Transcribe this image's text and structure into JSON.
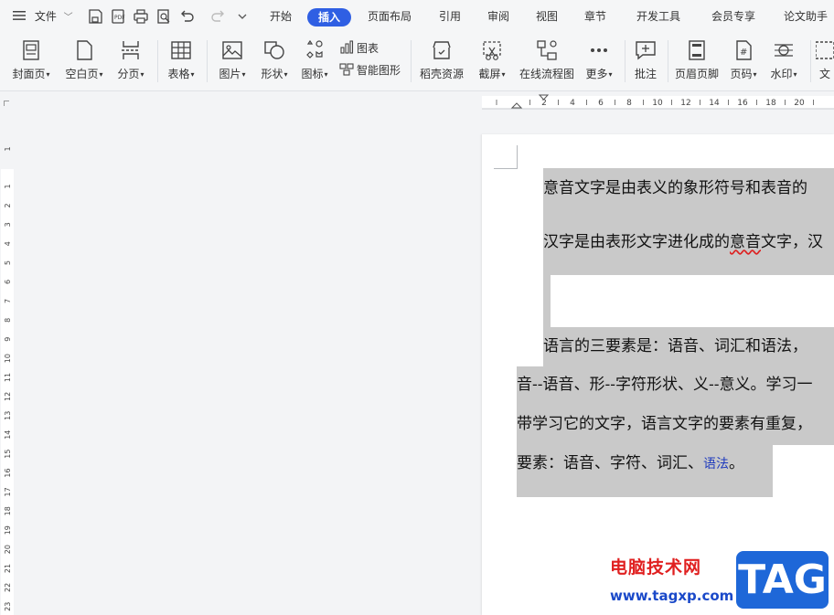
{
  "menu": {
    "file_label": "文件"
  },
  "tabs": [
    {
      "label": "开始"
    },
    {
      "label": "插入",
      "active": true
    },
    {
      "label": "页面布局"
    },
    {
      "label": "引用"
    },
    {
      "label": "审阅"
    },
    {
      "label": "视图"
    },
    {
      "label": "章节"
    },
    {
      "label": "开发工具"
    },
    {
      "label": "会员专享"
    },
    {
      "label": "论文助手"
    }
  ],
  "ribbon": {
    "cover": "封面页",
    "blank": "空白页",
    "break": "分页",
    "table": "表格",
    "picture": "图片",
    "shape": "形状",
    "icon": "图标",
    "chart": "图表",
    "smart_art": "智能图形",
    "resources": "稻壳资源",
    "screenshot": "截屏",
    "flowchart": "在线流程图",
    "more": "更多",
    "comment": "批注",
    "header_footer": "页眉页脚",
    "page_number": "页码",
    "watermark": "水印",
    "text_partial": "文"
  },
  "hruler": {
    "labels": [
      "2",
      "4",
      "6",
      "8",
      "10",
      "12",
      "14",
      "16",
      "18",
      "20"
    ]
  },
  "vruler": {
    "top_label": "1",
    "labels": [
      "1",
      "2",
      "3",
      "4",
      "5",
      "6",
      "7",
      "8",
      "9",
      "10",
      "11",
      "12",
      "13",
      "14",
      "15",
      "16",
      "17",
      "18",
      "19",
      "20",
      "21",
      "22",
      "23"
    ]
  },
  "document": {
    "line1": "意音文字是由表义的象形符号和表音的",
    "line2_pre": "汉字是由表形文字进化成的",
    "line2_err": "意音",
    "line2_post": "文字，汉",
    "line3": "语言的三要素是：语音、词汇和语法，",
    "line4": "音--语音、形--字符形状、义--意义。学习一",
    "line5": "带学习它的文字，语言文字的要素有重复，",
    "line6_pre": "要素：语音、字符、词汇、",
    "line6_link": "语法",
    "line6_post": "。"
  },
  "watermark": {
    "site_name": "电脑技术网",
    "url": "www.tagxp.com",
    "logo_text": "TAG"
  },
  "colors": {
    "accent": "#2f5fe3",
    "highlight": "#c9c9c9",
    "watermark_red": "#e02020",
    "watermark_blue": "#1a49c9",
    "logo_bg": "#1e67d8"
  }
}
